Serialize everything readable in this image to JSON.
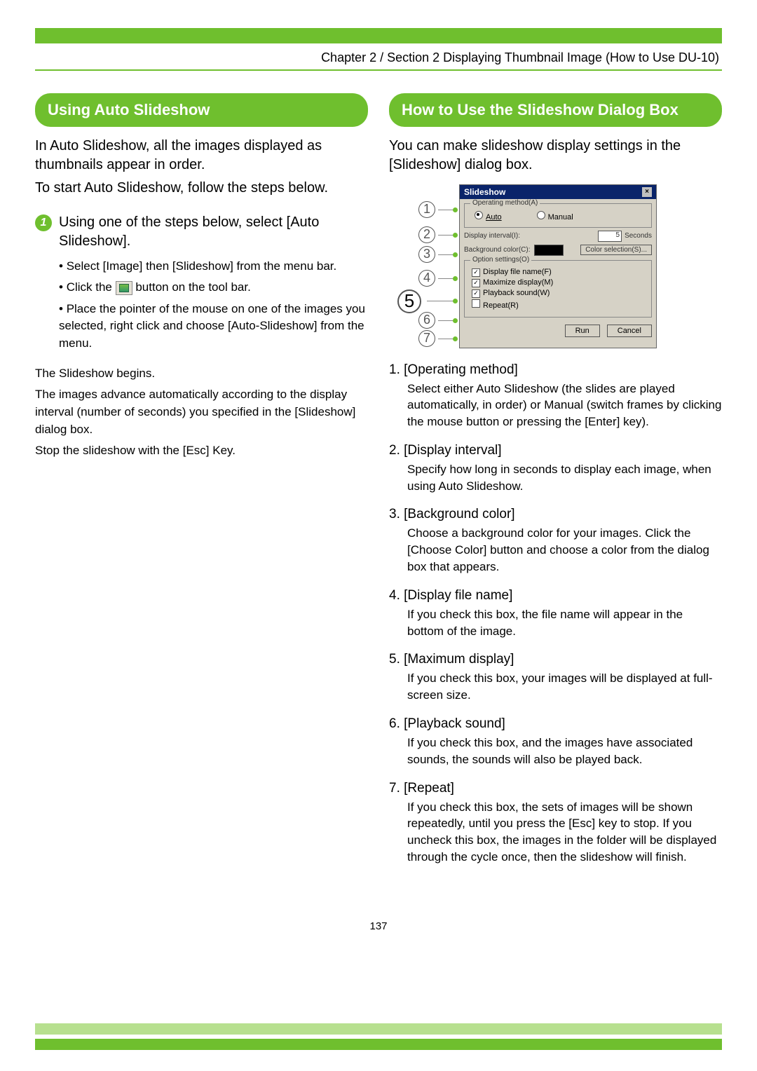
{
  "header": {
    "breadcrumb": "Chapter 2 / Section 2  Displaying Thumbnail Image (How to Use DU-10)"
  },
  "left": {
    "pill": "Using Auto Slideshow",
    "intro1": "In Auto Slideshow, all the images displayed as thumbnails appear in order.",
    "intro2": "To start Auto Slideshow, follow the steps below.",
    "step1_num": "1",
    "step1_text": "Using one of the steps below, select [Auto Slideshow].",
    "sub1": "Select [Image] then  [Slideshow] from the menu bar.",
    "sub2a": "Click the",
    "sub2b": "button on the tool bar.",
    "sub3": "Place the pointer of the mouse on one of the images you selected, right click and choose [Auto-Slideshow] from the menu.",
    "after1": "The Slideshow begins.",
    "after2": "The images advance automatically according to the display interval (number of seconds) you specified in the [Slideshow] dialog box.",
    "after3": "Stop the slideshow with the [Esc] Key."
  },
  "right": {
    "pill": "How to Use the Slideshow Dialog Box",
    "intro": "You can make slideshow display settings in the [Slideshow] dialog box.",
    "dialog_callouts": [
      "1",
      "2",
      "3",
      "4",
      "5",
      "6",
      "7"
    ],
    "dialog": {
      "title": "Slideshow",
      "op_legend": "Operating method(A)",
      "op_auto": "Auto",
      "op_manual": "Manual",
      "interval_label": "Display interval(I):",
      "interval_value": "5",
      "interval_unit": "Seconds",
      "bg_label": "Background color(C):",
      "bg_btn": "Color selection(S)...",
      "opt_legend": "Option settings(O)",
      "opt_file": "Display file name(F)",
      "opt_max": "Maximize display(M)",
      "opt_sound": "Playback sound(W)",
      "opt_repeat": "Repeat(R)",
      "run": "Run",
      "cancel": "Cancel"
    },
    "defs": [
      {
        "num": "1.",
        "title": "[Operating method]",
        "body": "Select either Auto Slideshow (the slides are played automatically, in order) or Manual (switch frames by clicking the mouse button or pressing the [Enter] key)."
      },
      {
        "num": "2.",
        "title": "[Display interval]",
        "body": "Specify how long in seconds to display each image, when using Auto Slideshow."
      },
      {
        "num": "3.",
        "title": "[Background color]",
        "body": "Choose a background color for your images. Click the [Choose Color] button and choose a color from the dialog box that appears."
      },
      {
        "num": "4.",
        "title": "[Display file name]",
        "body": "If you check this box, the file name will appear in the bottom of the image."
      },
      {
        "num": "5.",
        "title": "[Maximum display]",
        "body": "If you check this box, your images will be displayed at full-screen size."
      },
      {
        "num": "6.",
        "title": "[Playback sound]",
        "body": "If you check this box, and the images have associated sounds, the sounds will also be played back."
      },
      {
        "num": "7.",
        "title": "[Repeat]",
        "body": "If you check this box, the sets of images will be shown repeatedly, until you press the [Esc] key to stop. If you uncheck this box, the images in the folder will be displayed through the cycle once, then the slideshow will finish."
      }
    ]
  },
  "page_number": "137"
}
